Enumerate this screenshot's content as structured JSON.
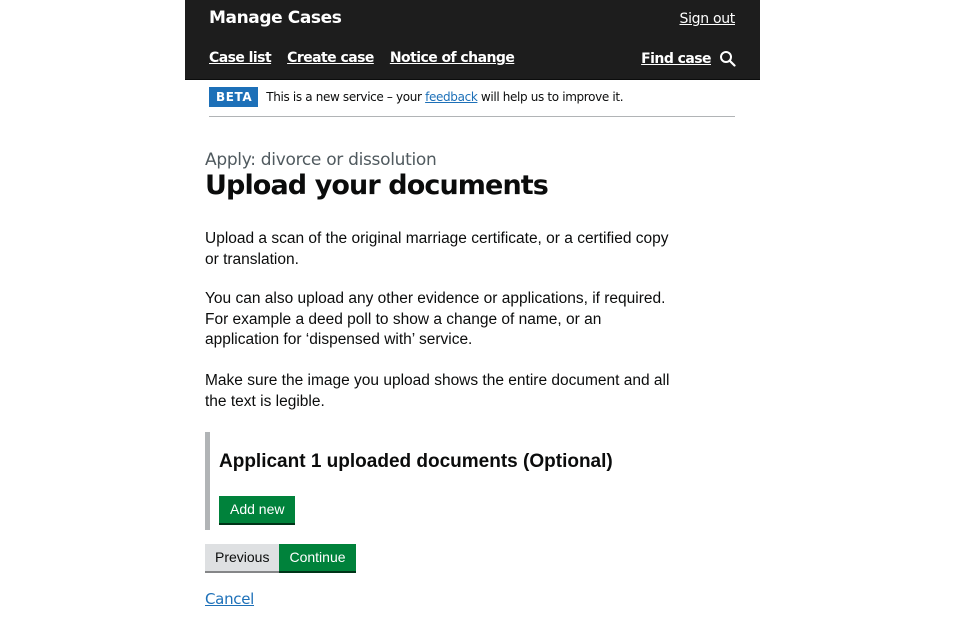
{
  "header": {
    "service_name": "Manage Cases",
    "sign_out_label": "Sign out",
    "nav": [
      {
        "label": "Case list"
      },
      {
        "label": "Create case"
      },
      {
        "label": "Notice of change"
      }
    ],
    "find_case_label": "Find case",
    "search_icon": "search-icon"
  },
  "phase_banner": {
    "tag": "BETA",
    "text_before": "This is a new service – your ",
    "link_text": "feedback",
    "text_after": " will help us to improve it."
  },
  "main": {
    "caption": "Apply: divorce or dissolution",
    "title": "Upload your documents",
    "paragraphs": [
      "Upload a scan of the original marriage certificate, or a certified copy or translation.",
      "You can also upload any other evidence or applications, if required. For example a deed poll to show a change of name, or an application for ‘dispensed with’ service.",
      "Make sure the image you upload shows the entire document and all the text is legible."
    ],
    "collection": {
      "heading": "Applicant 1 uploaded documents (Optional)",
      "add_new_label": "Add new"
    },
    "buttons": {
      "previous_label": "Previous",
      "continue_label": "Continue"
    },
    "cancel_label": "Cancel"
  },
  "colors": {
    "header_bg": "#1d1d1d",
    "link": "#1d70b8",
    "primary_button": "#00823b",
    "secondary_button": "#dee0e2",
    "beta_tag": "#1d70b8"
  }
}
